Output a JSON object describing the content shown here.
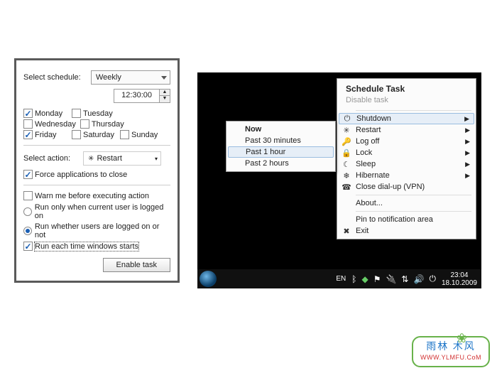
{
  "panel": {
    "schedule_label": "Select schedule:",
    "schedule_value": "Weekly",
    "time_value": "12:30:00",
    "days": [
      {
        "label": "Monday",
        "checked": true
      },
      {
        "label": "Tuesday",
        "checked": false
      },
      {
        "label": "Wednesday",
        "checked": false
      },
      {
        "label": "Thursday",
        "checked": false
      },
      {
        "label": "Friday",
        "checked": true
      },
      {
        "label": "Saturday",
        "checked": false
      },
      {
        "label": "Sunday",
        "checked": false
      }
    ],
    "action_label": "Select action:",
    "action_value": "Restart",
    "force_close": {
      "label": "Force applications to close",
      "checked": true
    },
    "warn": {
      "label": "Warn me before executing action",
      "checked": false
    },
    "run_current": {
      "label": "Run only when current user is logged on",
      "selected": false
    },
    "run_whether": {
      "label": "Run whether users are logged on or not",
      "selected": true
    },
    "run_each": {
      "label": "Run each time windows starts",
      "checked": true
    },
    "enable_btn": "Enable task"
  },
  "ctx": {
    "title": "Schedule Task",
    "disable": "Disable task",
    "shutdown": {
      "label": "Shutdown",
      "icon": "⏻"
    },
    "restart": {
      "label": "Restart",
      "icon": "✳"
    },
    "logoff": {
      "label": "Log off",
      "icon": "🔑"
    },
    "lock": {
      "label": "Lock",
      "icon": "🔒"
    },
    "sleep": {
      "label": "Sleep",
      "icon": "☾"
    },
    "hibernate": {
      "label": "Hibernate",
      "icon": "❄"
    },
    "dialup": {
      "label": "Close dial-up (VPN)",
      "icon": "☎"
    },
    "about": "About...",
    "pin": "Pin to notification area",
    "exit": {
      "label": "Exit",
      "icon": "✖"
    }
  },
  "submenu": {
    "now": "Now",
    "p30": "Past 30 minutes",
    "p1": "Past 1 hour",
    "p2": "Past 2 hours"
  },
  "taskbar": {
    "lang": "EN",
    "time": "23:04",
    "date": "18.10.2009"
  },
  "watermark": {
    "line1": "雨林 木风",
    "line2_a": "WWW.",
    "line2_b": "Y",
    "line2_c": "LMFU.C",
    "line2_d": "o",
    "line2_e": "M"
  }
}
